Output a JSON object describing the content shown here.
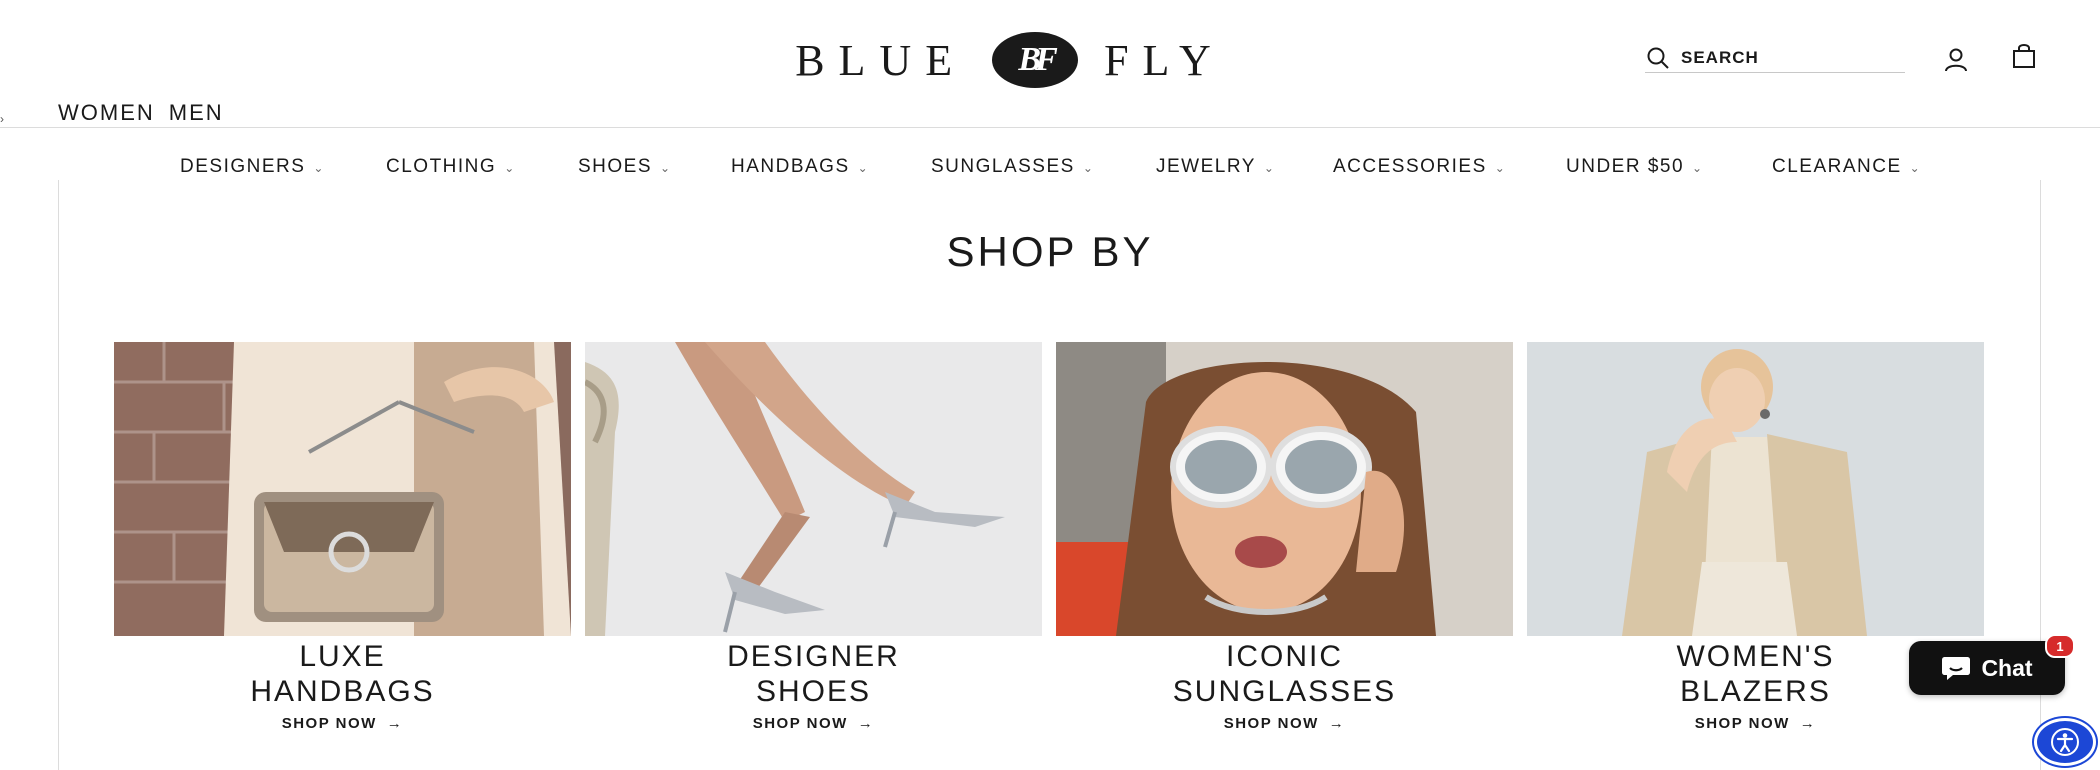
{
  "brand": {
    "logo_left": "BLUE",
    "logo_monogram": "BF",
    "logo_right": "FLY"
  },
  "header": {
    "search_placeholder": "SEARCH",
    "gender_tabs": [
      "WOMEN",
      "MEN"
    ],
    "account_icon": "user-icon",
    "cart_icon": "shopping-bag-icon",
    "search_icon": "magnifier-icon"
  },
  "nav": {
    "items": [
      {
        "label": "DESIGNERS"
      },
      {
        "label": "CLOTHING"
      },
      {
        "label": "SHOES"
      },
      {
        "label": "HANDBAGS"
      },
      {
        "label": "SUNGLASSES"
      },
      {
        "label": "JEWELRY"
      },
      {
        "label": "ACCESSORIES"
      },
      {
        "label": "UNDER $50"
      },
      {
        "label": "CLEARANCE"
      }
    ],
    "chevron": "⌄"
  },
  "shop_by": {
    "title": "SHOP BY",
    "tiles": [
      {
        "title": "LUXE\nHANDBAGS",
        "cta": "SHOP NOW"
      },
      {
        "title": "DESIGNER\nSHOES",
        "cta": "SHOP NOW"
      },
      {
        "title": "ICONIC\nSUNGLASSES",
        "cta": "SHOP NOW"
      },
      {
        "title": "WOMEN'S\nBLAZERS",
        "cta": "SHOP NOW"
      }
    ],
    "cta_arrow": "→"
  },
  "chat": {
    "label": "Chat",
    "badge_count": "1"
  },
  "colors": {
    "text": "#1a1a1a",
    "chat_bg": "#111111",
    "badge": "#d62b2b",
    "accessibility": "#1c47d6"
  }
}
